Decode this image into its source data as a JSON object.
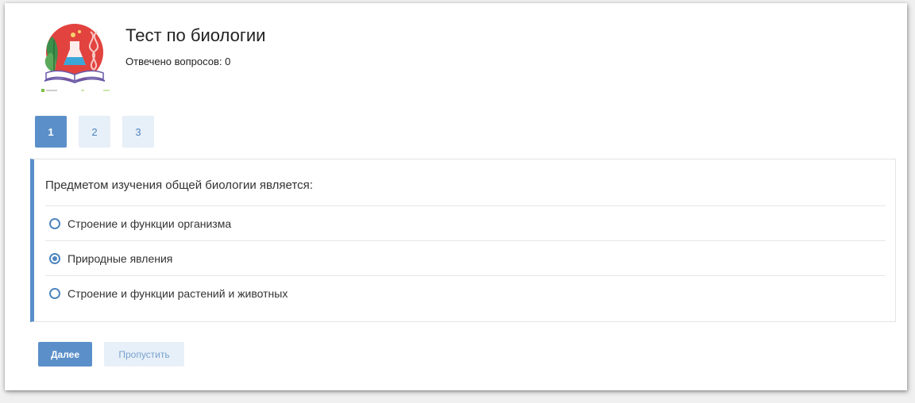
{
  "test": {
    "title": "Тест по биологии",
    "answered": "Отвечено вопросов: 0"
  },
  "pager": {
    "pages": [
      "1",
      "2",
      "3"
    ],
    "active": "1"
  },
  "question": {
    "text": "Предметом изучения общей биологии является:",
    "options": [
      {
        "label": "Строение и функции организма",
        "selected": false
      },
      {
        "label": "Природные явления",
        "selected": true
      },
      {
        "label": "Строение и функции растений и животных",
        "selected": false
      }
    ]
  },
  "buttons": {
    "next_label": "Далее",
    "skip_label": "Пропустить"
  },
  "colors": {
    "accent": "#5b8fc9",
    "accent_light": "#e7eff8",
    "logo_red": "#e2433f"
  },
  "icons": {
    "logo": "biology-book-flask-logo"
  }
}
